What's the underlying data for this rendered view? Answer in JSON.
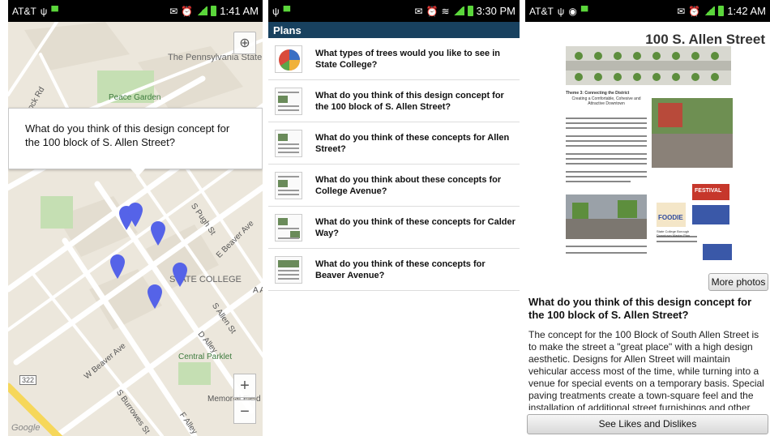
{
  "screen1": {
    "status": {
      "carrier": "AT&T",
      "time": "1:41 AM"
    },
    "map_labels": {
      "university": "The Pennsylvania State University",
      "peace_garden": "Peace Garden",
      "pollock_rd": "Pollock Rd",
      "pugh_st": "S Pugh St",
      "e_beaver": "E Beaver Ave",
      "state_college": "STATE COLLEGE",
      "s_allen": "S Allen St",
      "d_alley": "D Alley",
      "w_beaver": "W Beaver Ave",
      "central_parklet": "Central Parklet",
      "route": "322",
      "s_burrowes": "S Burrowes St",
      "f_alley": "F Alley",
      "memorial_field": "Memorial Field",
      "a_label": "A A",
      "google": "Google"
    },
    "callout": "What do you think of this design concept for the 100 block of S. Allen Street?",
    "zoom_in": "+",
    "zoom_out": "−"
  },
  "screen2": {
    "status": {
      "time": "3:30 PM"
    },
    "header": "Plans",
    "items": [
      {
        "label": "What types of trees would you like to see in State College?"
      },
      {
        "label": "What do you think of this design concept for the 100 block of S. Allen Street?"
      },
      {
        "label": "What do you think of these concepts for Allen Street?"
      },
      {
        "label": "What do you think about these concepts for College Avenue?"
      },
      {
        "label": "What do you think of these concepts for Calder Way?"
      },
      {
        "label": "What do you think of these concepts for Beaver Avenue?"
      }
    ]
  },
  "screen3": {
    "status": {
      "carrier": "AT&T",
      "time": "1:42 AM"
    },
    "title": "100 S. Allen Street",
    "poster": {
      "theme": "Theme 3: Connecting the District",
      "subtitle": "Creating a Comfortable, Cohesive and Attractive Downtown",
      "foodie": "FOODIE",
      "festival": "FESTIVAL",
      "borough": "State College Borough Downtown Master Plan"
    },
    "more_photos": "More photos",
    "question": "What do you think of this design concept for the 100 block of S. Allen Street?",
    "body": "The concept for the 100 Block of South Allen Street is to make the street a \"great place\" with a high design aesthetic. Designs for Allen Street will maintain vehicular access most of the time, while turning into a venue for special events on a temporary basis. Special paving treatments create a town-square feel and the installation of additional street furnishings and other features that will enhance the streetscape.",
    "likes_button": "See Likes and Dislikes"
  },
  "colors": {
    "header": "#18415f",
    "pin": "#5563e8",
    "status_green": "#5bd63b"
  }
}
